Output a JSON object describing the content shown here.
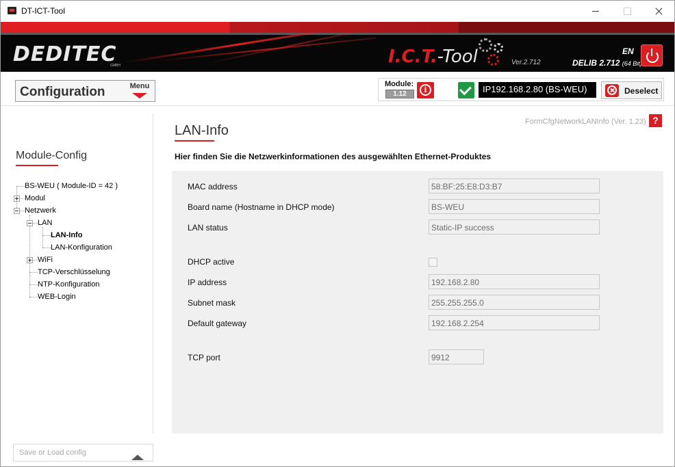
{
  "window": {
    "title": "DT-ICT-Tool"
  },
  "banner": {
    "brand": "DEDITEC",
    "brand_sub": "GMBH",
    "app_name_red": "I.C.T.",
    "app_name_white": "-Tool",
    "version": "Ver.2.712",
    "language": "EN",
    "delib": "DELIB 2.712",
    "delib_bits": "(64 Bit)"
  },
  "toolbar": {
    "config_title": "Configuration",
    "menu_label": "Menu",
    "module_label": "Module:",
    "module_version": "1.12",
    "ip_text": "IP192.168.2.80 (BS-WEU)",
    "deselect_label": "Deselect"
  },
  "sidebar": {
    "title": "Module-Config",
    "tree": [
      {
        "label": "BS-WEU ( Module-ID = 42 )"
      },
      {
        "label": "Modul"
      },
      {
        "label": "Netzwerk"
      },
      {
        "label": "LAN"
      },
      {
        "label": "LAN-Info"
      },
      {
        "label": "LAN-Konfiguration"
      },
      {
        "label": "WiFi"
      },
      {
        "label": "TCP-Verschlüsselung"
      },
      {
        "label": "NTP-Konfiguration"
      },
      {
        "label": "WEB-Login"
      }
    ],
    "save_load_placeholder": "Save or Load config"
  },
  "main": {
    "title": "LAN-Info",
    "form_id": "FormCfgNetworkLANInfo (Ver. 1.23)",
    "help_label": "?",
    "subtitle": "Hier finden Sie die Netzwerkinformationen des ausgewählten Ethernet-Produktes",
    "fields": {
      "mac": {
        "label": "MAC address",
        "value": "58:BF:25:E8:D3:B7"
      },
      "board_name": {
        "label": "Board name (Hostname in DHCP mode)",
        "value": "BS-WEU"
      },
      "lan_status": {
        "label": "LAN status",
        "value": "Static-IP success"
      },
      "dhcp": {
        "label": "DHCP active",
        "checked": false
      },
      "ip": {
        "label": "IP address",
        "value": "192.168.2.80"
      },
      "subnet": {
        "label": "Subnet mask",
        "value": "255.255.255.0"
      },
      "gateway": {
        "label": "Default gateway",
        "value": "192.168.2.254"
      },
      "tcp_port": {
        "label": "TCP port",
        "value": "9912"
      }
    }
  },
  "colors": {
    "accent_red": "#d91f24",
    "confirm_green": "#1e9a45",
    "panel_bg": "#f0f0f0"
  }
}
